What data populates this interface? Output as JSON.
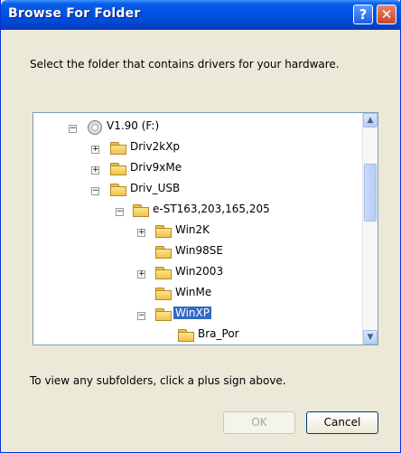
{
  "window": {
    "title": "Browse For Folder",
    "help_glyph": "?",
    "close_glyph": "✕"
  },
  "prompt": "Select the folder that contains drivers for your hardware.",
  "tree": {
    "items": [
      {
        "label": "V1.90 (F:)",
        "expander": "−",
        "icon": "cd-drive-icon"
      },
      {
        "label": "Driv2kXp",
        "expander": "+",
        "icon": "folder-icon"
      },
      {
        "label": "Driv9xMe",
        "expander": "+",
        "icon": "folder-icon"
      },
      {
        "label": "Driv_USB",
        "expander": "−",
        "icon": "folder-icon"
      },
      {
        "label": "e-ST163,203,165,205",
        "expander": "−",
        "icon": "folder-icon"
      },
      {
        "label": "Win2K",
        "expander": "+",
        "icon": "folder-icon"
      },
      {
        "label": "Win98SE",
        "expander": "",
        "icon": "folder-icon"
      },
      {
        "label": "Win2003",
        "expander": "+",
        "icon": "folder-icon"
      },
      {
        "label": "WinMe",
        "expander": "",
        "icon": "folder-icon"
      },
      {
        "label": "WinXP",
        "expander": "−",
        "icon": "open-folder-icon",
        "selected": true
      },
      {
        "label": "Bra_Por",
        "expander": "",
        "icon": "folder-icon"
      }
    ],
    "scroll_up_glyph": "▲",
    "scroll_down_glyph": "▼"
  },
  "hint": "To view any subfolders, click a plus sign above.",
  "buttons": {
    "ok": "OK",
    "cancel": "Cancel"
  },
  "colors": {
    "titlebar": "#0054e3",
    "dialog_bg": "#ece9d8",
    "selection": "#316ac5"
  }
}
